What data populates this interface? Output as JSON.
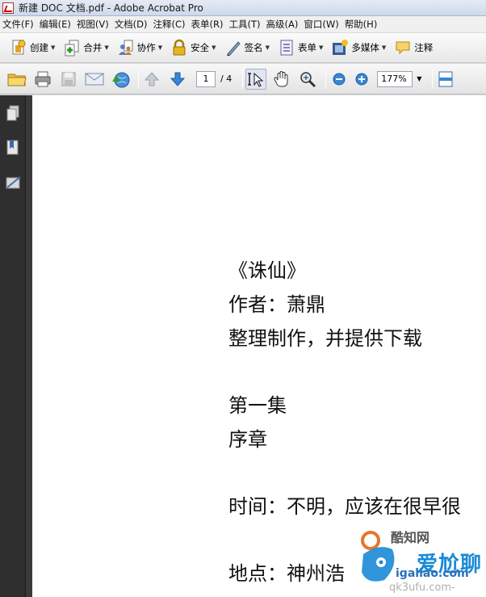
{
  "window": {
    "title": "新建 DOC 文档.pdf - Adobe Acrobat Pro"
  },
  "menu": [
    {
      "label": "文件(F)"
    },
    {
      "label": "编辑(E)"
    },
    {
      "label": "视图(V)"
    },
    {
      "label": "文档(D)"
    },
    {
      "label": "注释(C)"
    },
    {
      "label": "表单(R)"
    },
    {
      "label": "工具(T)"
    },
    {
      "label": "高级(A)"
    },
    {
      "label": "窗口(W)"
    },
    {
      "label": "帮助(H)"
    }
  ],
  "tasks_toolbar": {
    "create": "创建",
    "combine": "合并",
    "collaborate": "协作",
    "secure": "安全",
    "sign": "签名",
    "forms": "表单",
    "multimedia": "多媒体",
    "comment": "注释"
  },
  "nav_toolbar": {
    "page_current": "1",
    "page_total": "/ 4",
    "zoom": "177%"
  },
  "document": {
    "lines": [
      "《诛仙》",
      "作者：萧鼎",
      "整理制作，并提供下载",
      "",
      "第一集",
      "序章",
      "",
      "时间：不明，应该在很早很",
      "",
      "地点：神州浩"
    ]
  },
  "watermark": {
    "brand": "爱尬聊",
    "url": "igaliao.com",
    "partial": "qk3ufu.com-",
    "logo_text": "酷知网"
  },
  "colors": {
    "nav_pane": "#2f2f2f",
    "accent_blue": "#3a7fd5",
    "watermark_blue": "#1a8ad6"
  }
}
